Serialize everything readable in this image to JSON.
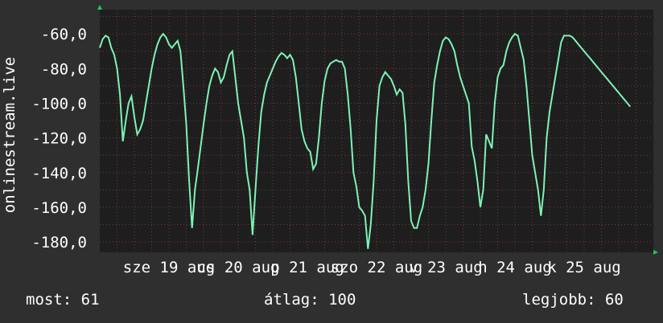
{
  "colors": {
    "background": "#2f2f2f",
    "plot_background": "#1e1e1e",
    "line": "#7ef2b6",
    "grid": "#c94a4a",
    "axis_arrow": "#22c94a",
    "text": "#ffffff"
  },
  "stats": {
    "current": "most: 61",
    "average": "átlag: 100",
    "best": "legjobb: 60"
  },
  "chart_data": {
    "type": "line",
    "title": "",
    "ylabel": "onlinestream.live",
    "xlabel": "",
    "x_ticks": [
      "sze 19 aug",
      "cs 20 aug",
      "p 21 aug",
      "szo 22 aug",
      "v 23 aug",
      "h 24 aug",
      "k 25 aug"
    ],
    "x_tick_hours": [
      24,
      48,
      72,
      96,
      120,
      144,
      168
    ],
    "y_ticks": [
      -60,
      -80,
      -100,
      -120,
      -140,
      -160,
      -180
    ],
    "y_tick_labels": [
      "-60,0",
      "-80,0",
      "-100,0",
      "-120,0",
      "-140,0",
      "-160,0",
      "-180,0"
    ],
    "ylim": [
      -186,
      -46
    ],
    "xlim": [
      0,
      192
    ],
    "grid": true,
    "series": [
      {
        "name": "",
        "x_hours": [
          0,
          1,
          2,
          3,
          4,
          5,
          6,
          7,
          8,
          9,
          10,
          11,
          12,
          13,
          14,
          15,
          16,
          17,
          18,
          19,
          20,
          21,
          22,
          23,
          24,
          25,
          26,
          27,
          28,
          29,
          30,
          31,
          32,
          33,
          34,
          35,
          36,
          37,
          38,
          39,
          40,
          41,
          42,
          43,
          44,
          45,
          46,
          47,
          48,
          49,
          50,
          51,
          52,
          53,
          54,
          55,
          56,
          57,
          58,
          59,
          60,
          61,
          62,
          63,
          64,
          65,
          66,
          67,
          68,
          69,
          70,
          71,
          72,
          73,
          74,
          75,
          76,
          77,
          78,
          79,
          80,
          81,
          82,
          83,
          84,
          85,
          86,
          87,
          88,
          89,
          90,
          91,
          92,
          93,
          94,
          95,
          96,
          97,
          98,
          99,
          100,
          101,
          102,
          103,
          104,
          105,
          106,
          107,
          108,
          109,
          110,
          111,
          112,
          113,
          114,
          115,
          116,
          117,
          118,
          119,
          120,
          121,
          122,
          123,
          124,
          125,
          126,
          127,
          128,
          129,
          130,
          131,
          132,
          133,
          134,
          135,
          136,
          137,
          138,
          139,
          140,
          141,
          142,
          143,
          144,
          145,
          146,
          147,
          148,
          149,
          150,
          151,
          152,
          153,
          154,
          155,
          156,
          157,
          158,
          159,
          160,
          161,
          162,
          163,
          164,
          165,
          166,
          167,
          168,
          169,
          170,
          171,
          172,
          173,
          174,
          175,
          176,
          177,
          178,
          179,
          180,
          181,
          182,
          183,
          184,
          185,
          186,
          187,
          188,
          189,
          190,
          191,
          192
        ],
        "values": [
          -68,
          -63,
          -61,
          -62,
          -68,
          -72,
          -80,
          -95,
          -122,
          -110,
          -100,
          -96,
          -108,
          -118,
          -115,
          -110,
          -100,
          -90,
          -80,
          -72,
          -66,
          -62,
          -60,
          -62,
          -66,
          -68,
          -66,
          -64,
          -70,
          -90,
          -112,
          -145,
          -172,
          -150,
          -138,
          -125,
          -112,
          -100,
          -90,
          -84,
          -80,
          -82,
          -88,
          -85,
          -78,
          -72,
          -70,
          -85,
          -100,
          -110,
          -120,
          -140,
          -150,
          -176,
          -150,
          -125,
          -105,
          -95,
          -88,
          -84,
          -80,
          -76,
          -73,
          -71,
          -72,
          -74,
          -72,
          -75,
          -85,
          -100,
          -115,
          -122,
          -126,
          -128,
          -138,
          -135,
          -120,
          -100,
          -87,
          -80,
          -77,
          -76,
          -75,
          -76,
          -76,
          -80,
          -95,
          -115,
          -140,
          -148,
          -160,
          -162,
          -165,
          -184,
          -170,
          -145,
          -110,
          -90,
          -85,
          -82,
          -84,
          -86,
          -90,
          -95,
          -92,
          -94,
          -112,
          -145,
          -168,
          -172,
          -172,
          -165,
          -160,
          -150,
          -135,
          -110,
          -88,
          -78,
          -70,
          -64,
          -62,
          -63,
          -66,
          -70,
          -78,
          -85,
          -90,
          -95,
          -100,
          -125,
          -133,
          -145,
          -160,
          -150,
          -118,
          -122,
          -126,
          -100,
          -85,
          -80,
          -78,
          -70,
          -65,
          -62,
          -60,
          -61,
          -68,
          -75,
          -90,
          -110,
          -130,
          -140,
          -150,
          -165,
          -150,
          -120,
          -105,
          -95,
          -85,
          -75,
          -65,
          -61,
          -61,
          -61,
          -62,
          -64,
          -66,
          -68,
          -70,
          -72,
          -74,
          -76,
          -78,
          -80,
          -82,
          -84,
          -86,
          -88,
          -90,
          -92,
          -94,
          -96,
          -98,
          -100,
          -102
        ]
      }
    ]
  }
}
